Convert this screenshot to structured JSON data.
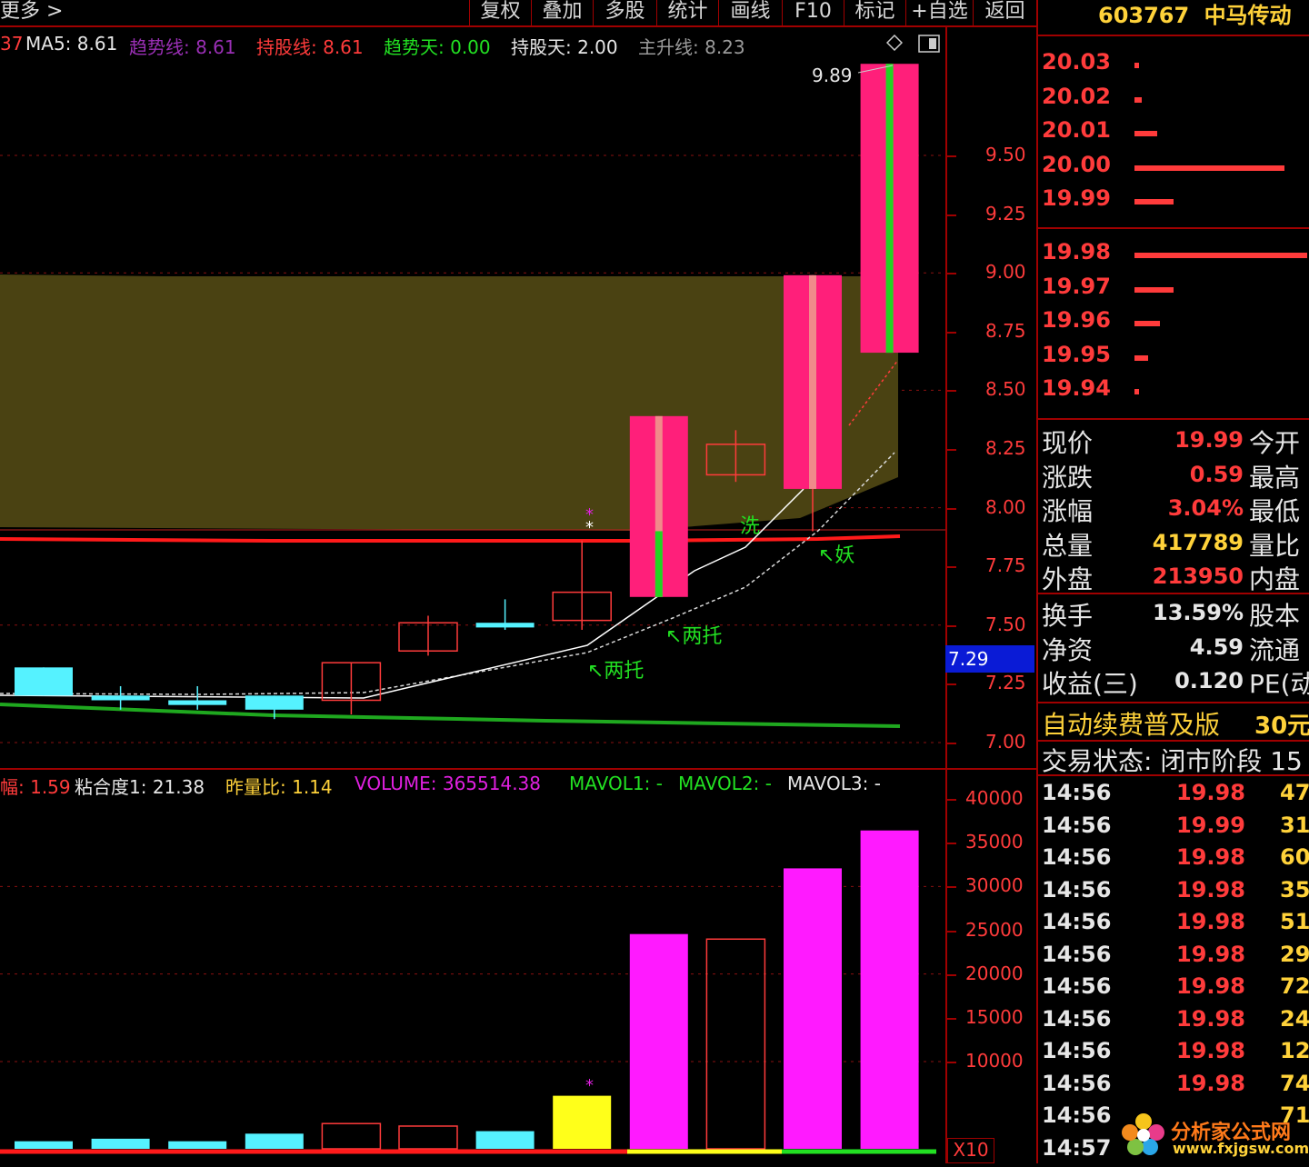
{
  "toolbar": {
    "more": "更多 >",
    "buttons": [
      "复权",
      "叠加",
      "多股",
      "统计",
      "画线",
      "F10",
      "标记",
      "+自选",
      "返回"
    ]
  },
  "stock": {
    "code": "603767",
    "name": "中马传动"
  },
  "indicators": {
    "prefix": "37",
    "ma5": "MA5: 8.61",
    "trend_line": "趋势线: 8.61",
    "hold_line": "持股线: 8.61",
    "trend_days": "趋势天: 0.00",
    "hold_days": "持股天: 2.00",
    "main_rise": "主升线: 8.23"
  },
  "volume_indicators": {
    "amp": "幅: 1.59",
    "stick": "粘合度1: 21.38",
    "ratio": "昨量比: 1.14",
    "volume": "VOLUME: 365514.38",
    "mavol1": "MAVOL1: -",
    "mavol2": "MAVOL2: -",
    "mavol3": "MAVOL3: -"
  },
  "price_axis": [
    "9.50",
    "9.25",
    "9.00",
    "8.75",
    "8.50",
    "8.25",
    "8.00",
    "7.75",
    "7.50",
    "7.25",
    "7.00"
  ],
  "current_price_tag": "7.29",
  "high_label": "9.89",
  "volume_axis": [
    "40000",
    "35000",
    "30000",
    "25000",
    "20000",
    "15000",
    "10000"
  ],
  "volume_multiplier": "X10",
  "annotations": {
    "wash": "洗",
    "demon": "↖妖",
    "two_support_1": "↖两托",
    "two_support_2": "↖两托",
    "star": "*"
  },
  "order_book": {
    "asks": [
      {
        "price": "20.03",
        "size": 2
      },
      {
        "price": "20.02",
        "size": 3
      },
      {
        "price": "20.01",
        "size": 10
      },
      {
        "price": "20.00",
        "size": 66
      },
      {
        "price": "19.99",
        "size": 17
      }
    ],
    "bids": [
      {
        "price": "19.98",
        "size": 76
      },
      {
        "price": "19.97",
        "size": 17
      },
      {
        "price": "19.96",
        "size": 11
      },
      {
        "price": "19.95",
        "size": 6
      },
      {
        "price": "19.94",
        "size": 2
      }
    ]
  },
  "quote": [
    {
      "label": "现价",
      "value": "19.99",
      "label2": "今开",
      "color": "#ff3b3b"
    },
    {
      "label": "涨跌",
      "value": "0.59",
      "label2": "最高",
      "color": "#ff3b3b"
    },
    {
      "label": "涨幅",
      "value": "3.04%",
      "label2": "最低",
      "color": "#ff3b3b"
    },
    {
      "label": "总量",
      "value": "417789",
      "label2": "量比",
      "color": "#ffd23a"
    },
    {
      "label": "外盘",
      "value": "213950",
      "label2": "内盘",
      "color": "#ff3b3b"
    },
    {
      "label": "换手",
      "value": "13.59%",
      "label2": "股本",
      "color": "#e6e6e6"
    },
    {
      "label": "净资",
      "value": "4.59",
      "label2": "流通",
      "color": "#e6e6e6"
    },
    {
      "label": "收益(三)",
      "value": "0.120",
      "label2": "PE(动",
      "color": "#e6e6e6"
    }
  ],
  "promo": {
    "text": "自动续费普及版",
    "price": "30元"
  },
  "trade_status": "交易状态: 闭市阶段 15",
  "ticks": [
    {
      "time": "14:56",
      "price": "19.98",
      "vol": "47"
    },
    {
      "time": "14:56",
      "price": "19.99",
      "vol": "31"
    },
    {
      "time": "14:56",
      "price": "19.98",
      "vol": "60"
    },
    {
      "time": "14:56",
      "price": "19.98",
      "vol": "35"
    },
    {
      "time": "14:56",
      "price": "19.98",
      "vol": "51"
    },
    {
      "time": "14:56",
      "price": "19.98",
      "vol": "29"
    },
    {
      "time": "14:56",
      "price": "19.98",
      "vol": "72"
    },
    {
      "time": "14:56",
      "price": "19.98",
      "vol": "24"
    },
    {
      "time": "14:56",
      "price": "19.98",
      "vol": "12"
    },
    {
      "time": "14:56",
      "price": "19.98",
      "vol": "74"
    },
    {
      "time": "14:56",
      "price": "",
      "vol": "71"
    },
    {
      "time": "14:57",
      "price": "",
      "vol": ""
    }
  ],
  "watermark": {
    "cn": "分析家公式网",
    "url": "www.fxjgsw.com"
  },
  "chart_data": {
    "type": "candlestick",
    "ylim": [
      6.95,
      9.95
    ],
    "candles": [
      {
        "open": 7.32,
        "close": 7.2,
        "high": 7.32,
        "low": 7.2,
        "kind": "down"
      },
      {
        "open": 7.2,
        "close": 7.18,
        "high": 7.24,
        "low": 7.14,
        "kind": "down"
      },
      {
        "open": 7.18,
        "close": 7.16,
        "high": 7.24,
        "low": 7.14,
        "kind": "down"
      },
      {
        "open": 7.2,
        "close": 7.14,
        "high": 7.2,
        "low": 7.1,
        "kind": "down"
      },
      {
        "open": 7.18,
        "close": 7.34,
        "high": 7.34,
        "low": 7.12,
        "kind": "up"
      },
      {
        "open": 7.39,
        "close": 7.51,
        "high": 7.54,
        "low": 7.37,
        "kind": "up"
      },
      {
        "open": 7.51,
        "close": 7.49,
        "high": 7.61,
        "low": 7.48,
        "kind": "down"
      },
      {
        "open": 7.52,
        "close": 7.64,
        "high": 7.86,
        "low": 7.48,
        "kind": "up"
      },
      {
        "open": 7.62,
        "close": 8.39,
        "high": 8.39,
        "low": 7.62,
        "kind": "limit"
      },
      {
        "open": 8.14,
        "close": 8.27,
        "high": 8.33,
        "low": 8.11,
        "kind": "up"
      },
      {
        "open": 8.08,
        "close": 8.99,
        "high": 8.99,
        "low": 7.9,
        "kind": "limit"
      },
      {
        "open": 8.66,
        "close": 9.89,
        "high": 9.89,
        "low": 8.66,
        "kind": "limit"
      }
    ],
    "volumes": [
      3,
      4,
      3,
      6,
      10,
      9,
      7,
      21,
      85,
      83,
      111,
      126
    ]
  }
}
